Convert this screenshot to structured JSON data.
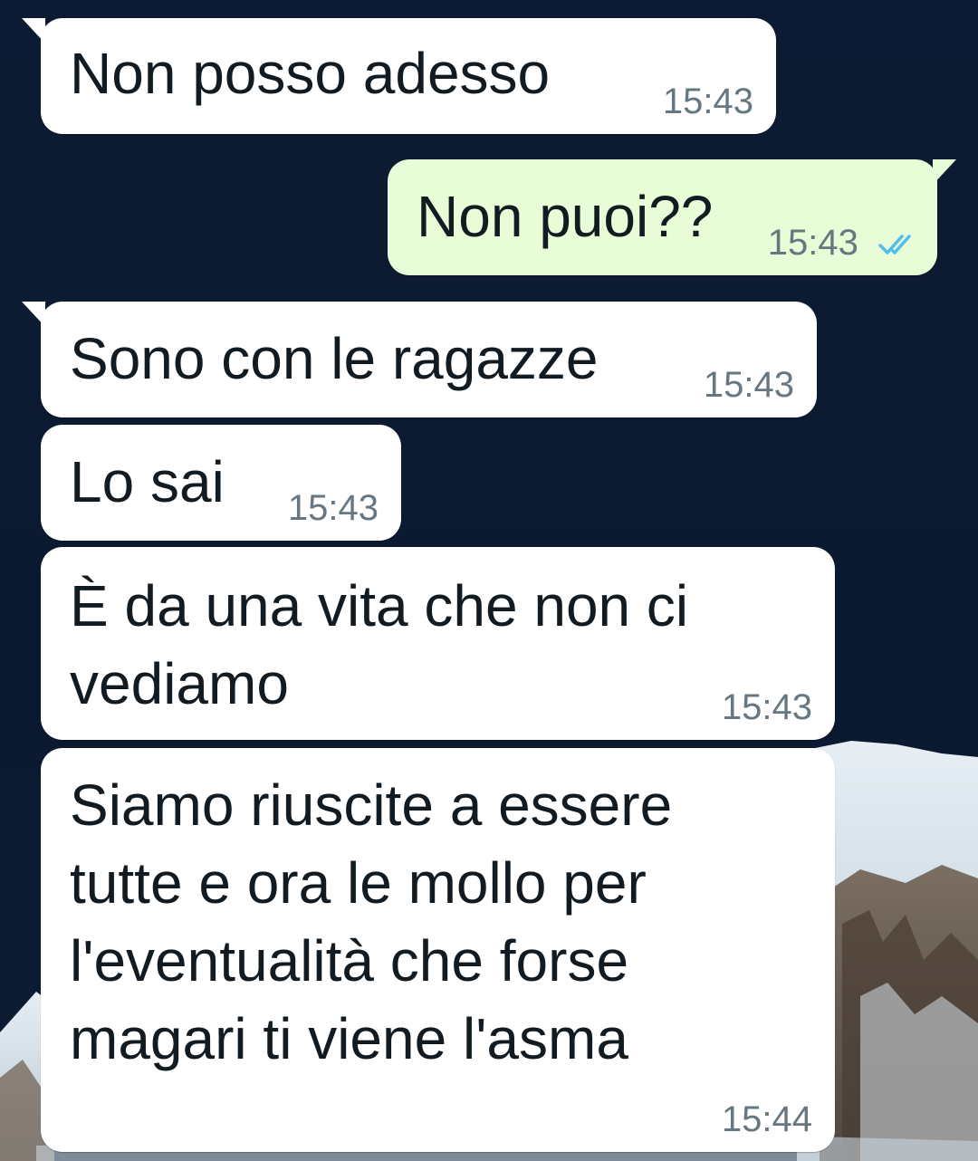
{
  "colors": {
    "incoming_bubble": "#ffffff",
    "outgoing_bubble": "#e7fcd7",
    "timestamp": "#667781",
    "read_ticks": "#53bdeb",
    "wallpaper": "#0b1930"
  },
  "messages": [
    {
      "direction": "incoming",
      "text": "Non posso adesso",
      "time": "15:43"
    },
    {
      "direction": "outgoing",
      "text": "Non puoi??",
      "time": "15:43",
      "status_icon": "double-check-read-icon"
    },
    {
      "direction": "incoming",
      "text": "Sono con le ragazze",
      "time": "15:43"
    },
    {
      "direction": "incoming",
      "text": "Lo sai",
      "time": "15:43"
    },
    {
      "direction": "incoming",
      "text": "È da una vita che non ci\nvediamo",
      "time": "15:43"
    },
    {
      "direction": "incoming",
      "text": "Siamo riuscite a essere\ntutte e ora le mollo per\nl'eventualità che forse\nmagari ti viene l'asma",
      "time": "15:44"
    }
  ],
  "wallpaper_icon": "snowy-mountain-wallpaper"
}
